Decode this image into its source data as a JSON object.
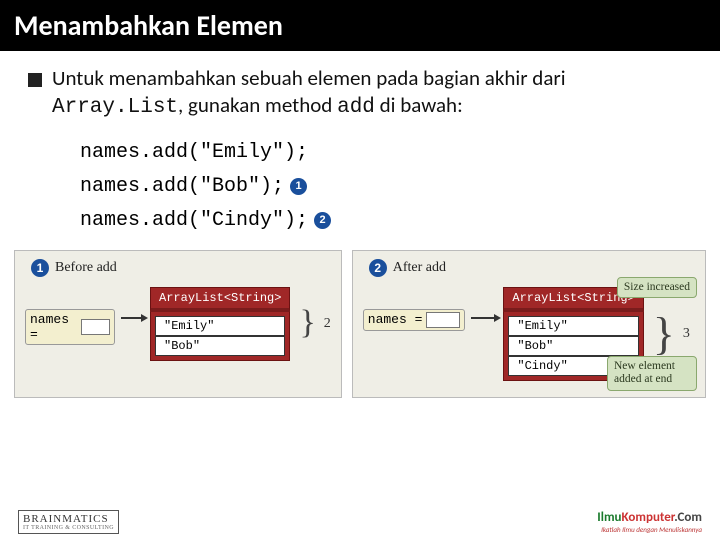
{
  "title": "Menambahkan Elemen",
  "bullet": {
    "pre": "Untuk menambahkan sebuah elemen pada bagian akhir dari ",
    "code1": "Array.List",
    "mid": ", gunakan method ",
    "code2": "add",
    "post": " di bawah:"
  },
  "code": {
    "line1": "names.add(\"Emily\");",
    "line2": "names.add(\"Bob\");",
    "line3": "names.add(\"Cindy\");",
    "badge1": "1",
    "badge2": "2"
  },
  "panel1": {
    "num": "1",
    "caption": "Before add",
    "var": "names =",
    "objType": "ArrayList<String>",
    "cells": [
      "\"Emily\"",
      "\"Bob\""
    ],
    "count": "2"
  },
  "panel2": {
    "num": "2",
    "caption": "After add",
    "var": "names =",
    "objType": "ArrayList<String>",
    "cells": [
      "\"Emily\"",
      "\"Bob\"",
      "\"Cindy\""
    ],
    "count": "3",
    "note1": "Size increased",
    "note2": "New element added at end"
  },
  "footer": {
    "left_brand": "BRAINMATICS",
    "left_sub": "IT TRAINING & CONSULTING",
    "right_ilmu": "Ilmu",
    "right_komputer": "Komputer",
    "right_com": ".Com",
    "right_sub": "Ikatlah Ilmu dengan Menuliskannya"
  }
}
